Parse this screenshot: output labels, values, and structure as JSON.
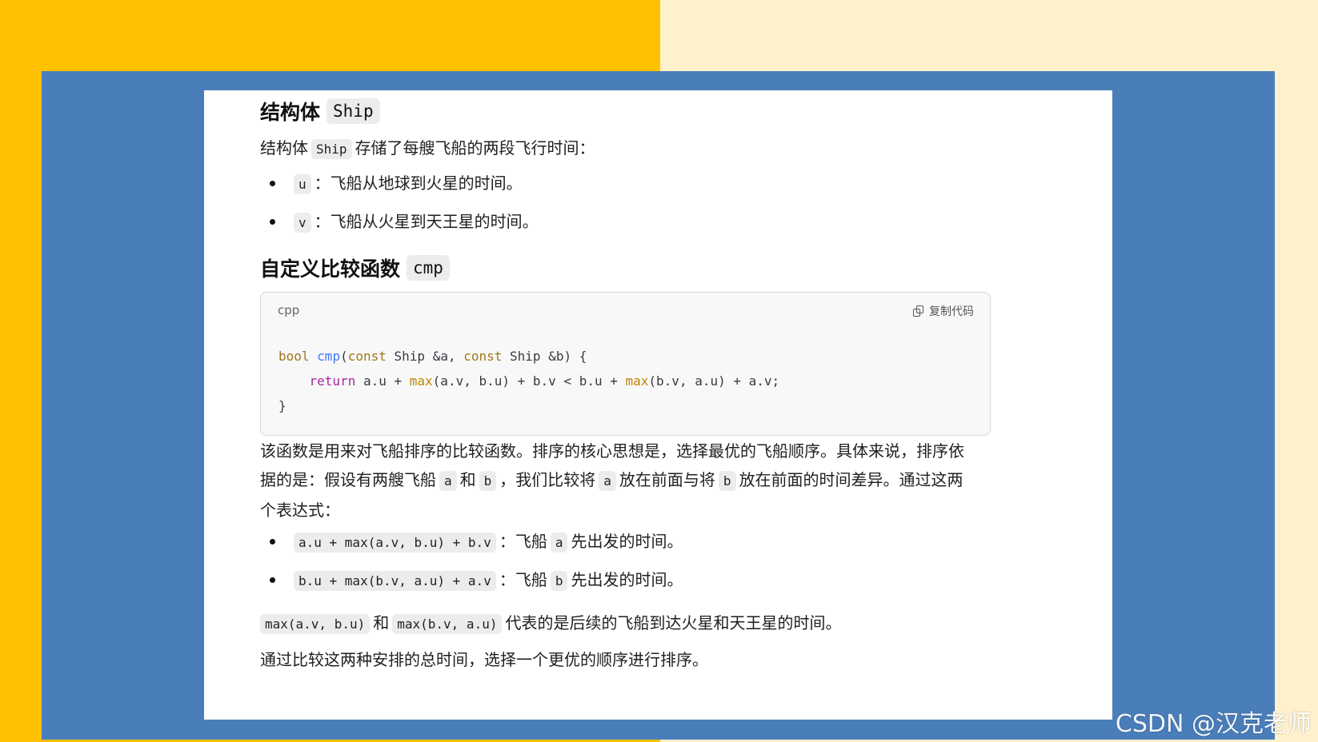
{
  "colors": {
    "left_bg": "#FFC000",
    "right_bg": "#FFF1CC",
    "slide": "#4A7EBB",
    "panel": "#FFFFFF"
  },
  "section1": {
    "title": "结构体",
    "title_code": "Ship",
    "intro_pre": "结构体",
    "intro_code": "Ship",
    "intro_post": "存储了每艘飞船的两段飞行时间：",
    "items": [
      {
        "code": "u",
        "text": "：飞船从地球到火星的时间。"
      },
      {
        "code": "v",
        "text": "：飞船从火星到天王星的时间。"
      }
    ]
  },
  "section2": {
    "title": "自定义比较函数",
    "title_code": "cmp",
    "code_lang": "cpp",
    "copy_label": "复制代码",
    "code": {
      "l1_kw": "bool",
      "l1_fn": "cmp",
      "l1_p1": "(",
      "l1_kw2": "const",
      "l1_p2": " Ship &a, ",
      "l1_kw3": "const",
      "l1_p3": " Ship &b) {",
      "l2_indent": "    ",
      "l2_ret": "return",
      "l2_a": " a.u + ",
      "l2_max1": "max",
      "l2_b": "(a.v, b.u) + b.v < b.u + ",
      "l2_max2": "max",
      "l2_c": "(b.v, a.u) + a.v;",
      "l3": "}"
    },
    "para1_a": "该函数是用来对飞船排序的比较函数。排序的核心思想是，选择最优的飞船顺序。具体来说，排序依",
    "para1_b_pre": "据的是：假设有两艘飞船",
    "para1_b_c1": "a",
    "para1_b_mid1": "和",
    "para1_b_c2": "b",
    "para1_b_mid2": "，我们比较将",
    "para1_b_c3": "a",
    "para1_b_mid3": "放在前面与将",
    "para1_b_c4": "b",
    "para1_b_post": "放在前面的时间差异。通过这两",
    "para1_c": "个表达式：",
    "items": [
      {
        "code": "a.u + max(a.v, b.u) + b.v",
        "pre": "：飞船",
        "c2": "a",
        "post": "先出发的时间。"
      },
      {
        "code": "b.u + max(b.v, a.u) + a.v",
        "pre": "：飞船",
        "c2": "b",
        "post": "先出发的时间。"
      }
    ],
    "para2_c1": "max(a.v, b.u)",
    "para2_mid": "和",
    "para2_c2": "max(b.v, a.u)",
    "para2_post": "代表的是后续的飞船到达火星和天王星的时间。",
    "para3": "通过比较这两种安排的总时间，选择一个更优的顺序进行排序。"
  },
  "watermark": "CSDN @汉克老师"
}
